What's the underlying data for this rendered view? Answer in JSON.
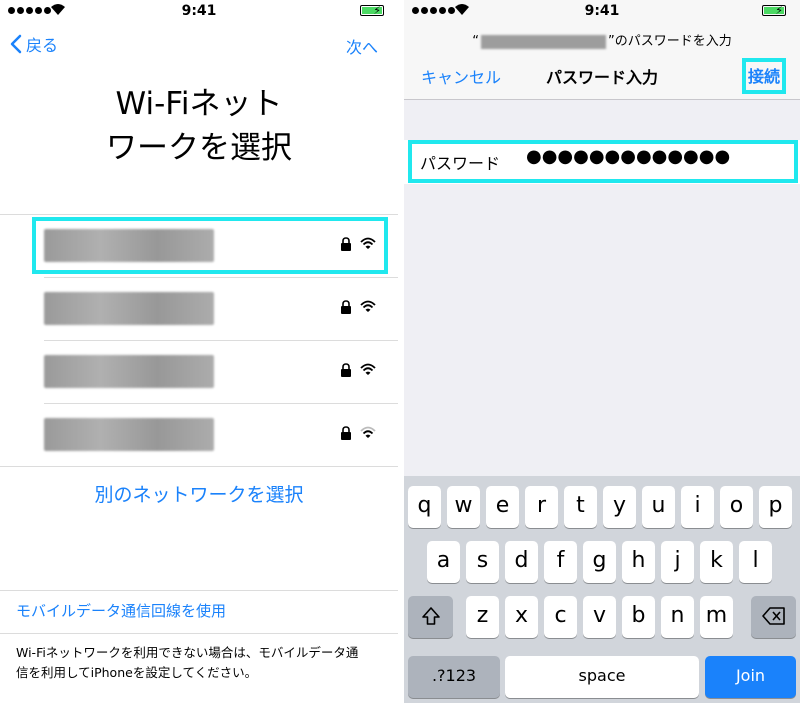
{
  "status": {
    "time": "9:41"
  },
  "left": {
    "nav": {
      "back_label": "戻る",
      "next_label": "次へ"
    },
    "title_line1": "Wi-Fiネット",
    "title_line2": "ワークを選択",
    "networks": [
      {
        "name": "",
        "secured": true,
        "signal": "full"
      },
      {
        "name": "",
        "secured": true,
        "signal": "full"
      },
      {
        "name": "",
        "secured": true,
        "signal": "full"
      },
      {
        "name": "",
        "secured": true,
        "signal": "weak"
      }
    ],
    "other_network_label": "別のネットワークを選択",
    "cellular_label": "モバイルデータ通信回線を使用",
    "footnote_line1": "Wi-Fiネットワークを利用できない場合は、モバイルデータ通",
    "footnote_line2": "信を利用してiPhoneを設定してください。"
  },
  "right": {
    "prompt_open": "“",
    "prompt_close": "”のパスワードを入力",
    "cancel_label": "キャンセル",
    "nav_title": "パスワード入力",
    "connect_label": "接続",
    "password_label": "パスワード",
    "password_value": "●●●●●●●●●●●●●",
    "keyboard": {
      "row1": [
        "q",
        "w",
        "e",
        "r",
        "t",
        "y",
        "u",
        "i",
        "o",
        "p"
      ],
      "row2": [
        "a",
        "s",
        "d",
        "f",
        "g",
        "h",
        "j",
        "k",
        "l"
      ],
      "row3": [
        "z",
        "x",
        "c",
        "v",
        "b",
        "n",
        "m"
      ],
      "numbers_label": ".?123",
      "space_label": "space",
      "join_label": "Join"
    }
  },
  "colors": {
    "accent": "#1a82fb",
    "highlight": "#20e8ee",
    "battery": "#4cd964"
  }
}
